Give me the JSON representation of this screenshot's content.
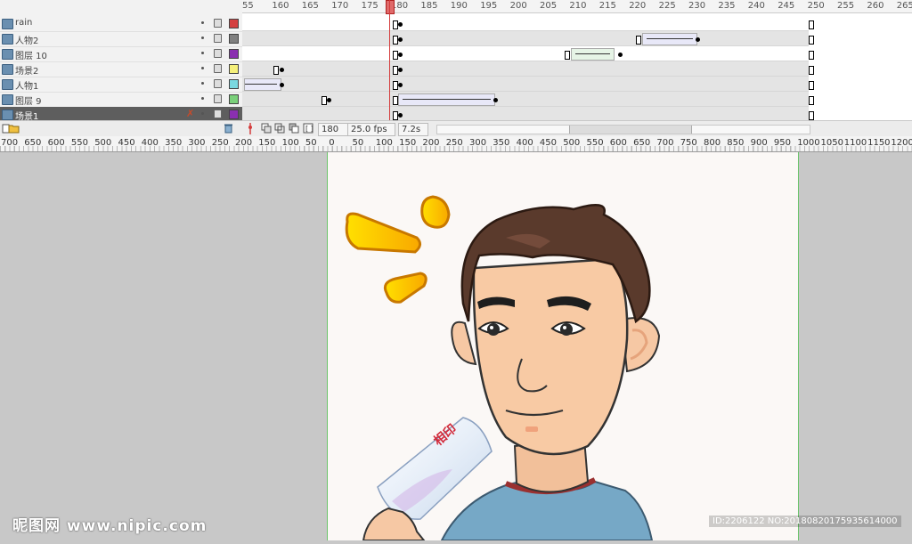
{
  "timeline": {
    "layers": [
      {
        "name": "rain",
        "color": "#d44040",
        "selected": false
      },
      {
        "name": "人物2",
        "color": "#808080",
        "selected": false
      },
      {
        "name": "图层 10",
        "color": "#8a2fb0",
        "selected": false
      },
      {
        "name": "场景2",
        "color": "#f5f07a",
        "selected": false
      },
      {
        "name": "人物1",
        "color": "#7ad8e0",
        "selected": false
      },
      {
        "name": "图层 9",
        "color": "#7ad07a",
        "selected": false
      },
      {
        "name": "场景1",
        "color": "#8a2fb0",
        "selected": true
      }
    ],
    "ruler_numbers": [
      "55",
      "160",
      "165",
      "170",
      "175",
      "180",
      "185",
      "190",
      "195",
      "200",
      "205",
      "210",
      "215",
      "220",
      "225",
      "230",
      "235",
      "240",
      "245",
      "250",
      "255",
      "260",
      "265"
    ],
    "status": {
      "current_frame": "180",
      "fps": "25.0 fps",
      "elapsed": "7.2s"
    },
    "playhead_color": "#d43c3c"
  },
  "stage_ruler": {
    "labels": [
      "700",
      "650",
      "600",
      "550",
      "500",
      "450",
      "400",
      "350",
      "300",
      "250",
      "200",
      "150",
      "100",
      "50",
      "0",
      "50",
      "100",
      "150",
      "200",
      "250",
      "300",
      "350",
      "400",
      "450",
      "500",
      "550",
      "600",
      "650",
      "700",
      "750",
      "800",
      "850",
      "900",
      "950",
      "1000",
      "1050",
      "1100",
      "1150",
      "1200"
    ]
  },
  "stage": {
    "background": "#fbf8f6",
    "packet_brand": "相印"
  },
  "watermarks": {
    "left": "昵图网 www.nipic.com",
    "right": "ID:2206122 NO:20180820175935614000"
  },
  "icons": {
    "eye": "eye-icon",
    "lock": "lock-icon",
    "outline": "outline-square-icon",
    "trash": "trash-icon",
    "new_layer": "new-layer-icon",
    "folder": "folder-icon"
  }
}
